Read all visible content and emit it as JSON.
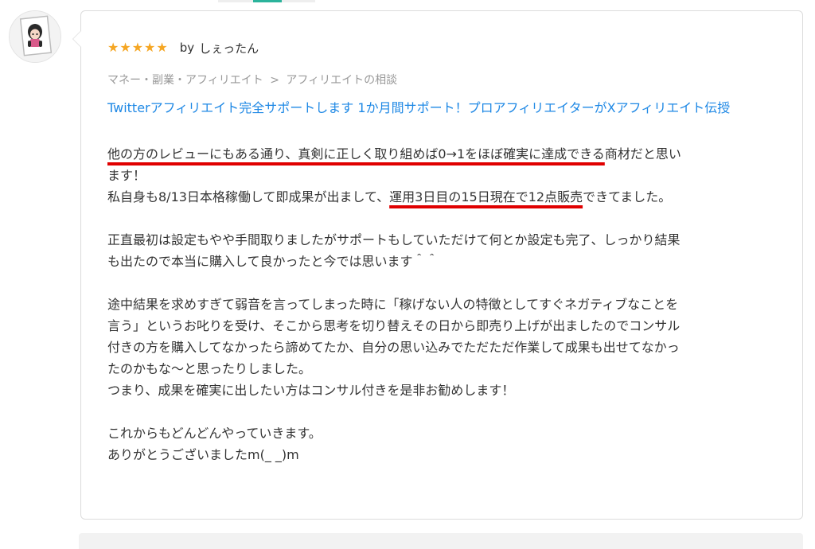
{
  "review": {
    "rating": 5,
    "stars": [
      "★",
      "★",
      "★",
      "★",
      "★"
    ],
    "by_label": "by",
    "reviewer_name": "しぇったん",
    "breadcrumb": {
      "category": "マネー・副業・アフィリエイト",
      "separator": ">",
      "subcategory": "アフィリエイトの相談"
    },
    "service_title": "Twitterアフィリエイト完全サポートします 1か月間サポート！プロアフィリエイターがXアフィリエイト伝授",
    "body": {
      "p1_hl": "他の方のレビューにもある通り、真剣に正しく取り組めば0→1をほぼ確実に達成できる",
      "p1_tail": "商材だと思い",
      "p1_l2": "ます！",
      "p2_pre": "私自身も8/13日本格稼働して即成果が出まして、",
      "p2_hl": "運用3日目の15日現在で12点販売",
      "p2_post": "できてました。",
      "p3_l1": "正直最初は設定もやや手間取りましたがサポートもしていただけて何とか設定も完了、しっかり結果",
      "p3_l2": "も出たので本当に購入して良かったと今では思います＾＾",
      "p4_l1": "途中結果を求めすぎて弱音を言ってしまった時に「稼げない人の特徴としてすぐネガティブなことを",
      "p4_l2": "言う」というお叱りを受け、そこから思考を切り替えその日から即売り上げが出ましたのでコンサル",
      "p4_l3": "付きの方を購入してなかったら諦めてたか、自分の思い込みでただただ作業して成果も出せてなかっ",
      "p4_l4": "たのかもな〜と思ったりしました。",
      "p4_l5": "つまり、成果を確実に出したい方はコンサル付きを是非お勧めします！",
      "p5_l1": "これからもどんどんやっていきます。",
      "p5_l2": "ありがとうございましたm(_ _)m"
    }
  },
  "colors": {
    "star": "#f5a623",
    "link": "#1e88e5",
    "breadcrumb": "#999999",
    "highlight_underline": "#e00000",
    "tab_accent": "#2bb39b"
  }
}
